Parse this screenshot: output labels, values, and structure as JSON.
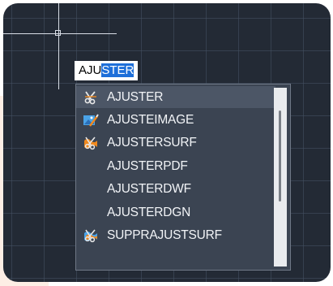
{
  "command_input": {
    "prefix": "AJU",
    "highlighted": "STER"
  },
  "suggestions": [
    {
      "label": "AJUSTER",
      "icon": "trim-scissors-icon",
      "selected": true
    },
    {
      "label": "AJUSTEIMAGE",
      "icon": "image-adjust-icon"
    },
    {
      "label": "AJUSTERSURF",
      "icon": "surface-trim-icon"
    },
    {
      "label": "AJUSTERPDF",
      "icon": ""
    },
    {
      "label": "AJUSTERDWF",
      "icon": ""
    },
    {
      "label": "AJUSTERDGN",
      "icon": ""
    },
    {
      "label": "SUPPRAJUSTSURF",
      "icon": "surface-untrim-icon"
    }
  ],
  "colors": {
    "canvas": "#232a35",
    "list_bg": "#3b4452",
    "selection": "#1e6fd9",
    "accent_orange": "#f0891e",
    "accent_blue": "#4aa3e8"
  }
}
